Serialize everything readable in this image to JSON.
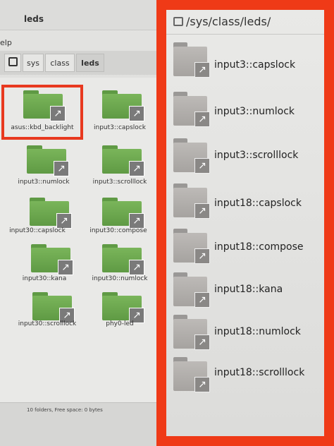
{
  "window": {
    "title": "leds",
    "menu_partial": "elp"
  },
  "breadcrumbs": [
    "sys",
    "class",
    "leds"
  ],
  "grid_items": [
    "asus::kbd_backlight",
    "input3::capslock",
    "input3::numlock",
    "input3::scrolllock",
    "input30::capslock",
    "input30::compose",
    "input30::kana",
    "input30::numlock",
    "input30::scrolllock",
    "phy0-led"
  ],
  "status_text": "10 folders, Free space: 0 bytes",
  "zoom": {
    "path": "/sys/class/leds/",
    "items": [
      "input3::capslock",
      "input3::numlock",
      "input3::scrolllock",
      "input18::capslock",
      "input18::compose",
      "input18::kana",
      "input18::numlock",
      "input18::scrolllock"
    ]
  },
  "colors": {
    "highlight": "#e8391f",
    "frame": "#ef3a17",
    "folder_green": "#6aa84f",
    "folder_gray": "#b1aeab"
  },
  "icons": {
    "folder": "folder-icon",
    "link": "symlink-arrow-icon",
    "home": "home-icon"
  }
}
